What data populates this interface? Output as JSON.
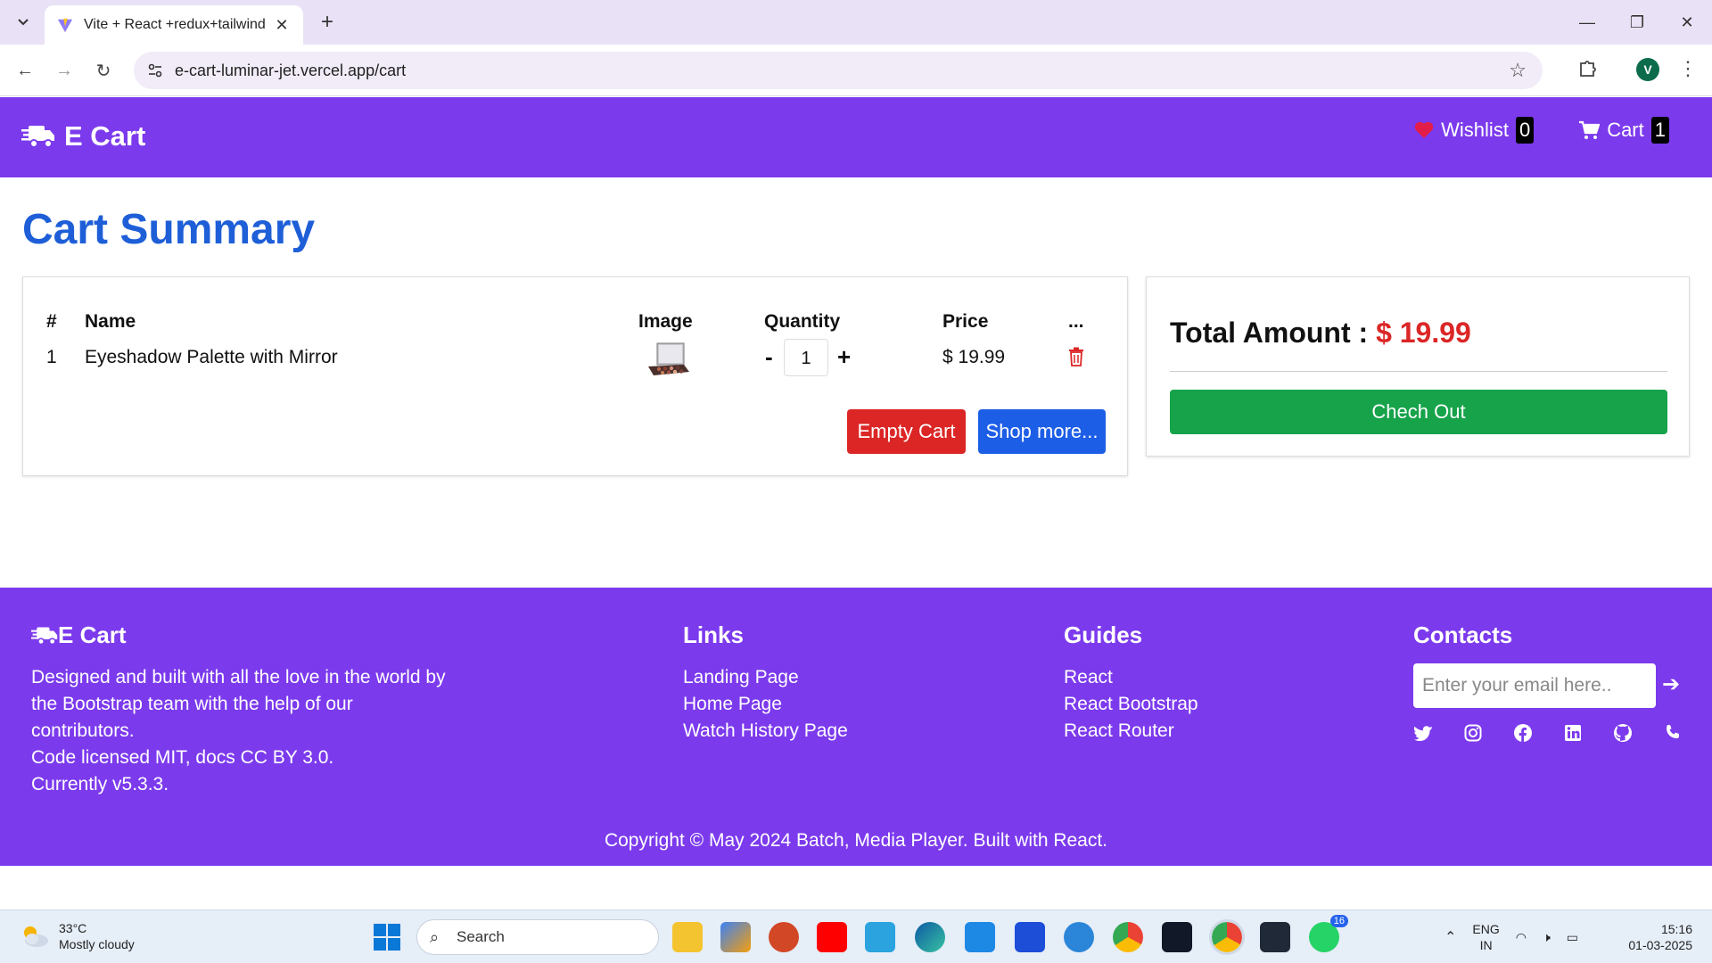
{
  "browser": {
    "tab_title": "Vite + React +redux+tailwind",
    "url": "e-cart-luminar-jet.vercel.app/cart",
    "profile_initial": "V"
  },
  "header": {
    "brand": "E Cart",
    "wishlist_label": "Wishlist",
    "wishlist_count": "0",
    "cart_label": "Cart",
    "cart_count": "1"
  },
  "main": {
    "title": "Cart Summary",
    "table": {
      "headers": [
        "#",
        "Name",
        "Image",
        "Quantity",
        "Price",
        "..."
      ],
      "rows": [
        {
          "index": "1",
          "name": "Eyeshadow Palette with Mirror",
          "quantity": "1",
          "price": "$ 19.99"
        }
      ]
    },
    "qty_minus": "-",
    "qty_plus": "+",
    "empty_cart_label": "Empty Cart",
    "shop_more_label": "Shop more...",
    "total_label": "Total Amount :",
    "total_value": "$ 19.99",
    "checkout_label": "Chech Out"
  },
  "footer": {
    "brand": "E Cart",
    "about_lines": [
      "Designed and built with all the love in the world by",
      "the Bootstrap team with the help of our",
      "contributors.",
      "Code licensed MIT, docs CC BY 3.0.",
      "Currently v5.3.3."
    ],
    "links_title": "Links",
    "links": [
      "Landing Page",
      "Home Page",
      "Watch History Page"
    ],
    "guides_title": "Guides",
    "guides": [
      "React",
      "React Bootstrap",
      "React Router"
    ],
    "contacts_title": "Contacts",
    "email_placeholder": "Enter your email here..",
    "copyright": "Copyright © May 2024 Batch, Media Player. Built with React."
  },
  "taskbar": {
    "temperature": "33°C",
    "weather": "Mostly cloudy",
    "search_placeholder": "Search",
    "whatsapp_badge": "16",
    "lang_top": "ENG",
    "lang_bottom": "IN",
    "time": "15:16",
    "date": "01-03-2025"
  },
  "colors": {
    "primary_purple": "#7c3aed",
    "title_blue": "#1e5fd8",
    "danger_red": "#dc2626",
    "shop_blue": "#1d5ee6",
    "checkout_green": "#16a34a"
  }
}
